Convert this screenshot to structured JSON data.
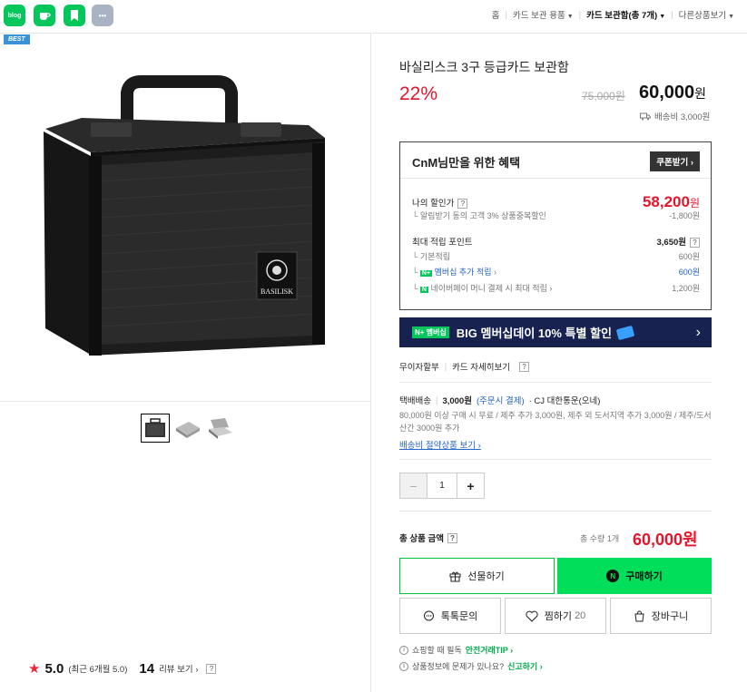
{
  "topbar": {
    "icons": [
      {
        "name": "blog-icon",
        "label": "blog",
        "color": "#03c75a"
      },
      {
        "name": "cafe-icon",
        "label": "☕",
        "color": "#03c75a"
      },
      {
        "name": "bookmark-app-icon",
        "label": "",
        "color": "#03c75a"
      },
      {
        "name": "more-icon",
        "label": "•••",
        "color": "#a9b3c4"
      }
    ],
    "breadcrumbs": [
      "홈",
      "카드 보관 용품",
      "카드 보관함(총 7개)",
      "다른상품보기"
    ]
  },
  "gallery": {
    "badge": "BEST",
    "thumbnails": [
      "case-front-thumb",
      "case-open-thumb",
      "case-inside-thumb"
    ],
    "brand_label": "BASILISK"
  },
  "rating": {
    "score": "5.0",
    "recent": "(최근 6개월 5.0)",
    "review_count": "14",
    "review_link": "리뷰 보기",
    "help": "?"
  },
  "product": {
    "title": "바실리스크 3구 등급카드 보관함",
    "discount": "22%",
    "original_price": "75,000원",
    "price": "60,000",
    "price_unit": "원",
    "shipping_fee": "배송비 3,000원"
  },
  "benefit": {
    "header": "CnM님만을 위한 혜택",
    "coupon_button": "쿠폰받기",
    "my_price_label": "나의 할인가",
    "my_price": "58,200",
    "my_price_unit": "원",
    "alarm_text": "알림받기 동의 고객 3% 상품중복할인",
    "alarm_discount": "-1,800원",
    "max_points_label": "최대 적립 포인트",
    "max_points": "3,650원",
    "basic_label": "기본적립",
    "basic_value": "600원",
    "membership_badge": "N+",
    "membership_label": "멤버십 추가 적립",
    "membership_value": "600원",
    "npay_badge": "N",
    "npay_label": "네이버페이 머니 결제 시 최대 적립",
    "npay_value": "1,200원"
  },
  "banner": {
    "badge": "N+ 멤버십",
    "text_prefix": "BIG 멤버십데이 ",
    "text_highlight": "10% 특별 할인",
    "arrow": "›"
  },
  "installment": {
    "label": "무이자할부",
    "link": "카드 자세히보기"
  },
  "delivery": {
    "type": "택배배송",
    "fee": "3,000원",
    "fee_note": "(주문시 결제)",
    "carrier": "· CJ 대한통운(오네)",
    "desc": "80,000원 이상 구매 시 무료 / 제주 추가 3,000원, 제주 외 도서지역 추가 3,000원 / 제주/도서산간 3000원 추가",
    "link": "배송비 절약상품 보기"
  },
  "quantity": {
    "value": "1",
    "minus": "−",
    "plus": "+"
  },
  "total": {
    "label": "총 상품 금액",
    "count_text": "총 수량 1개",
    "amount": "60,000원"
  },
  "actions": {
    "gift": "선물하기",
    "buy": "구매하기",
    "talk": "톡톡문의",
    "wish": "찜하기",
    "wish_count": "20",
    "cart": "장바구니"
  },
  "notices": {
    "safe_trade_prefix": "쇼핑할 때 필독",
    "safe_trade_link": "안전거래TIP",
    "report_prefix": "상품정보에 문제가 있나요?",
    "report_link": "신고하기"
  }
}
